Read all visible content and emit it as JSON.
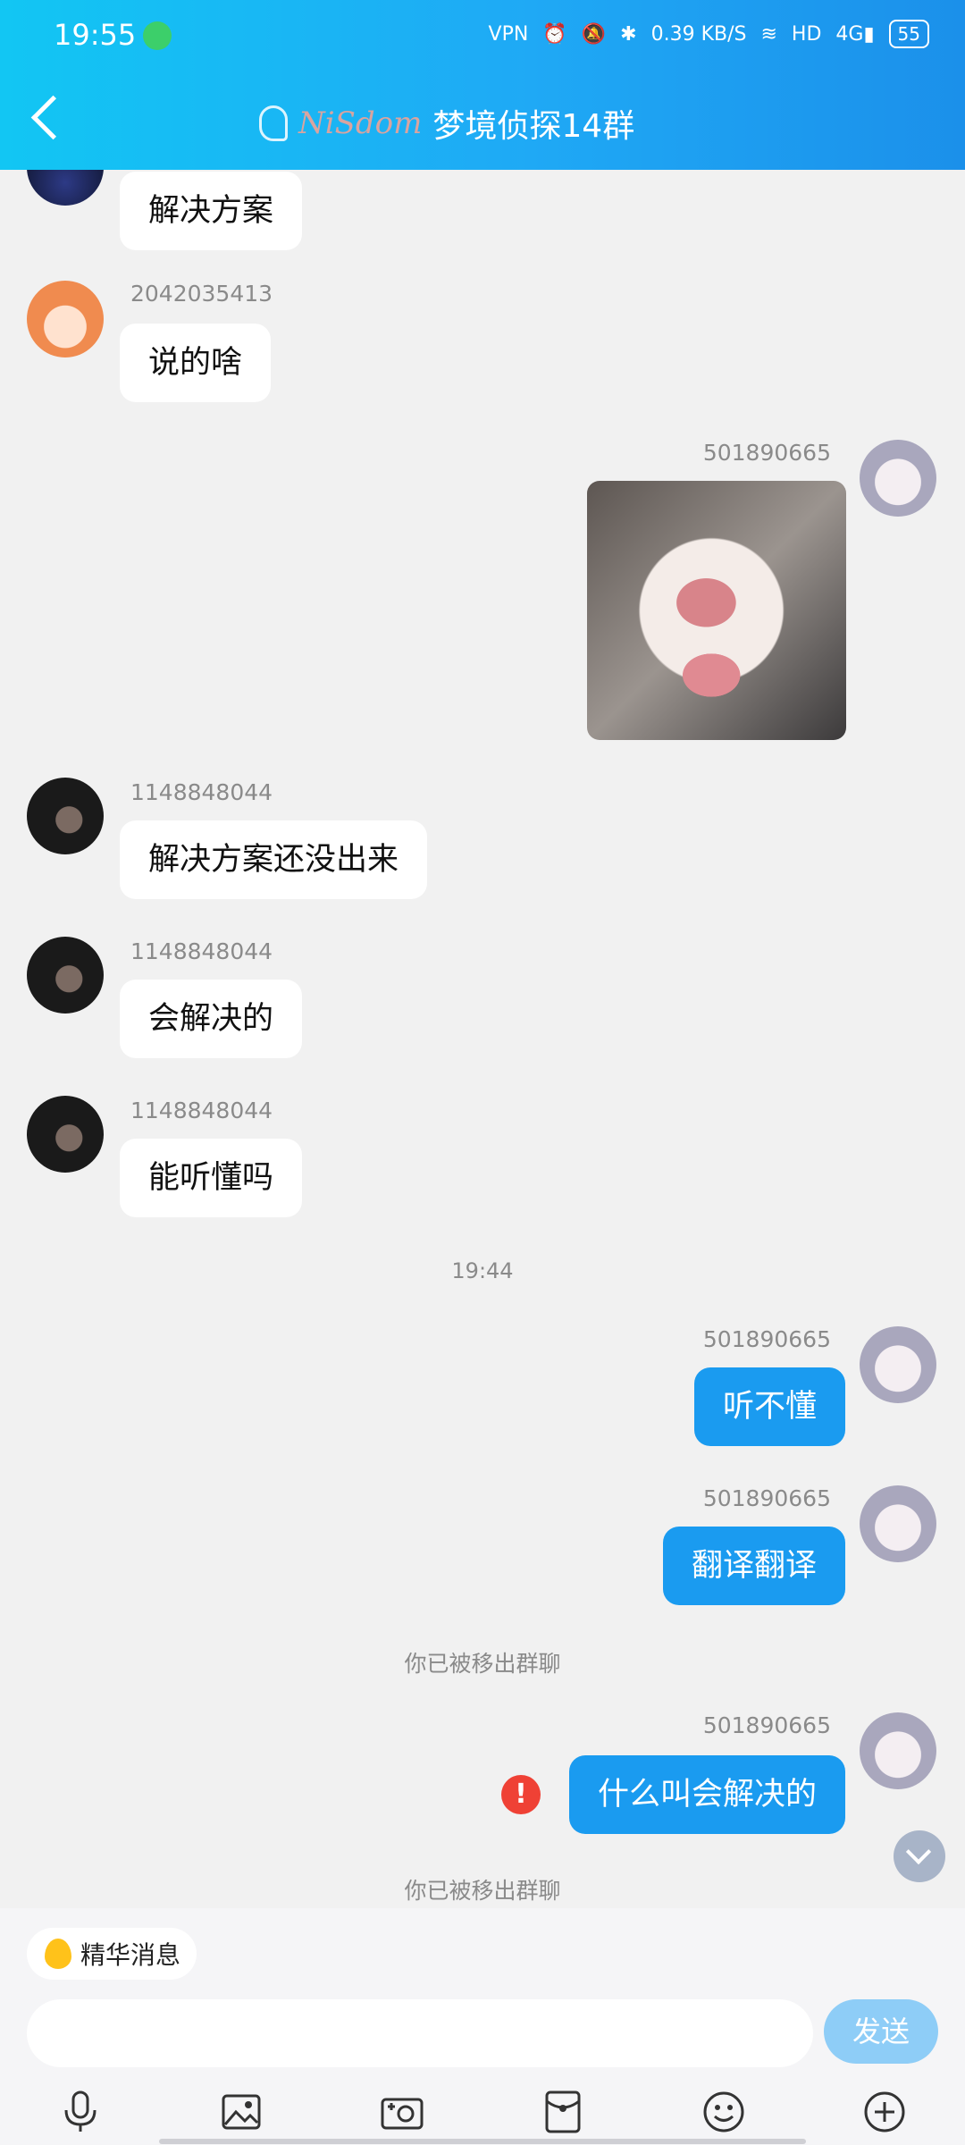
{
  "status_bar": {
    "time": "19:55",
    "speed": "0.39",
    "speed_unit": "KB/S",
    "battery": "55",
    "network": "4G",
    "hd": "HD",
    "vpn": "VPN"
  },
  "header": {
    "title": "梦境侦探14群",
    "logo_text": "NiSdom"
  },
  "messages": [
    {
      "id": "m0",
      "side": "in",
      "sender": "",
      "text": "解决方案"
    },
    {
      "id": "m1",
      "side": "in",
      "sender": "2042035413",
      "text": "说的啥"
    },
    {
      "id": "m2",
      "side": "out",
      "sender": "501890665",
      "text": ""
    },
    {
      "id": "m3",
      "side": "in",
      "sender": "1148848044",
      "text": "解决方案还没出来"
    },
    {
      "id": "m4",
      "side": "in",
      "sender": "1148848044",
      "text": "会解决的"
    },
    {
      "id": "m5",
      "side": "in",
      "sender": "1148848044",
      "text": "能听懂吗"
    },
    {
      "id": "m6",
      "side": "out",
      "sender": "501890665",
      "text": "听不懂"
    },
    {
      "id": "m7",
      "side": "out",
      "sender": "501890665",
      "text": "翻译翻译"
    },
    {
      "id": "m8",
      "side": "out",
      "sender": "501890665",
      "text": "什么叫会解决的"
    }
  ],
  "timestamp": "19:44",
  "system_notices": [
    "你已被移出群聊",
    "你已被移出群聊"
  ],
  "error_mark": "!",
  "bottom_bar": {
    "essence_label": "精华消息",
    "send_label": "发送",
    "input_placeholder": ""
  },
  "toolbar_icons": [
    "mic-icon",
    "image-icon",
    "camera-icon",
    "red-packet-icon",
    "emoji-icon",
    "plus-icon"
  ]
}
